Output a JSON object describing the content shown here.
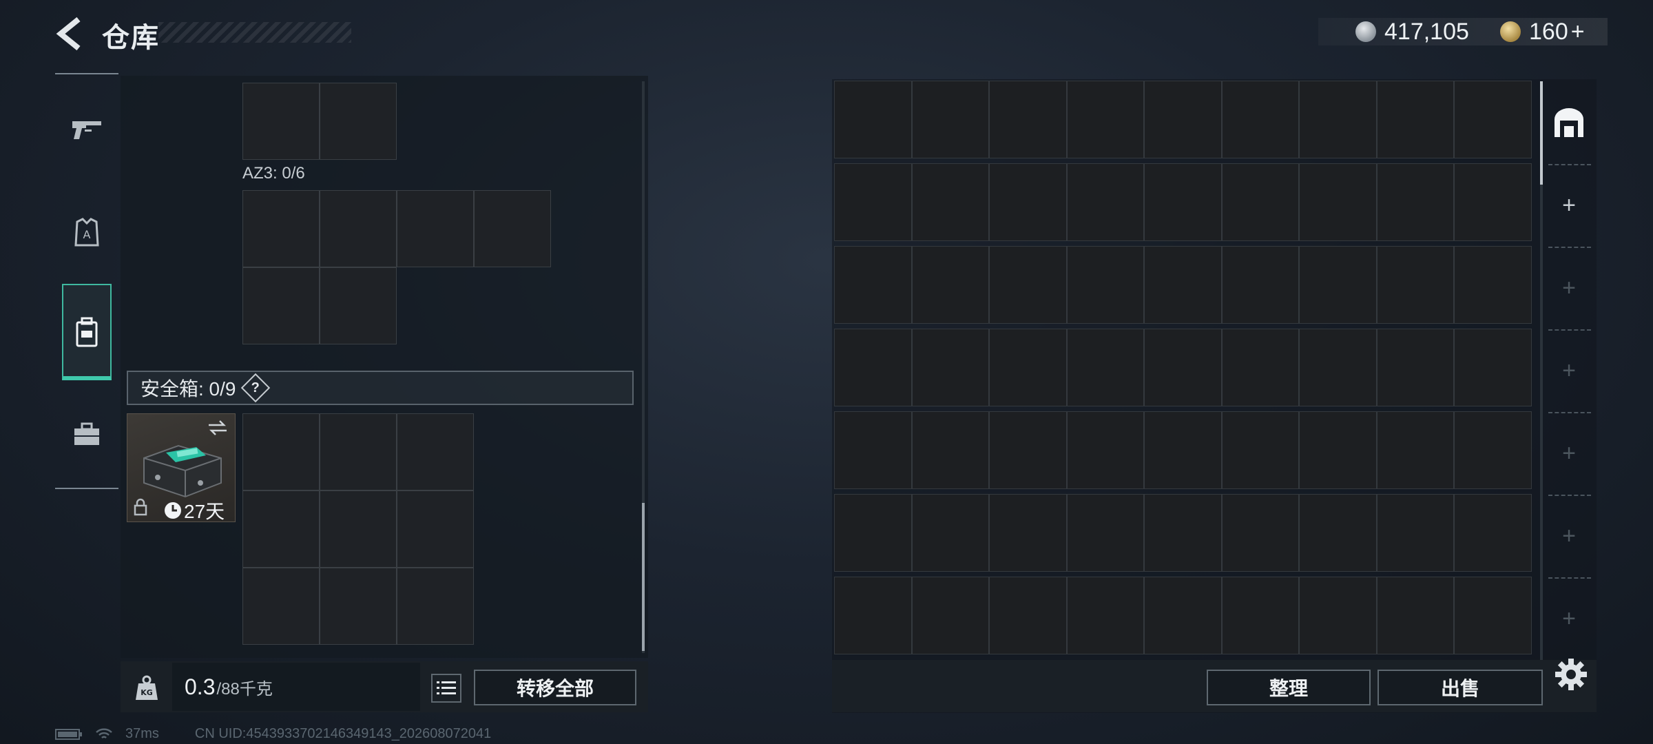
{
  "header": {
    "title": "仓库"
  },
  "currency": {
    "silver": "417,105",
    "gold": "160",
    "gold_add": "+"
  },
  "nav": {
    "items": [
      "weapon",
      "armor",
      "backpack",
      "case"
    ],
    "active": "backpack"
  },
  "left": {
    "rig_label": "AZ3: 0/6",
    "safe_label": "安全箱: 0/9",
    "safe_help": "?",
    "safe_days": "27天",
    "weight_value": "0.3",
    "weight_unit": "/88千克",
    "kg_label": "KG",
    "transfer_all": "转移全部"
  },
  "right": {
    "sort": "整理",
    "sell": "出售",
    "side_add": "+"
  },
  "status": {
    "ping": "37ms",
    "uid": "CN UID:4543933702146349143_202608072041"
  },
  "colors": {
    "accent": "#3fc9ac",
    "panel": "#1f2226",
    "grid_line": "#3a3f44"
  }
}
